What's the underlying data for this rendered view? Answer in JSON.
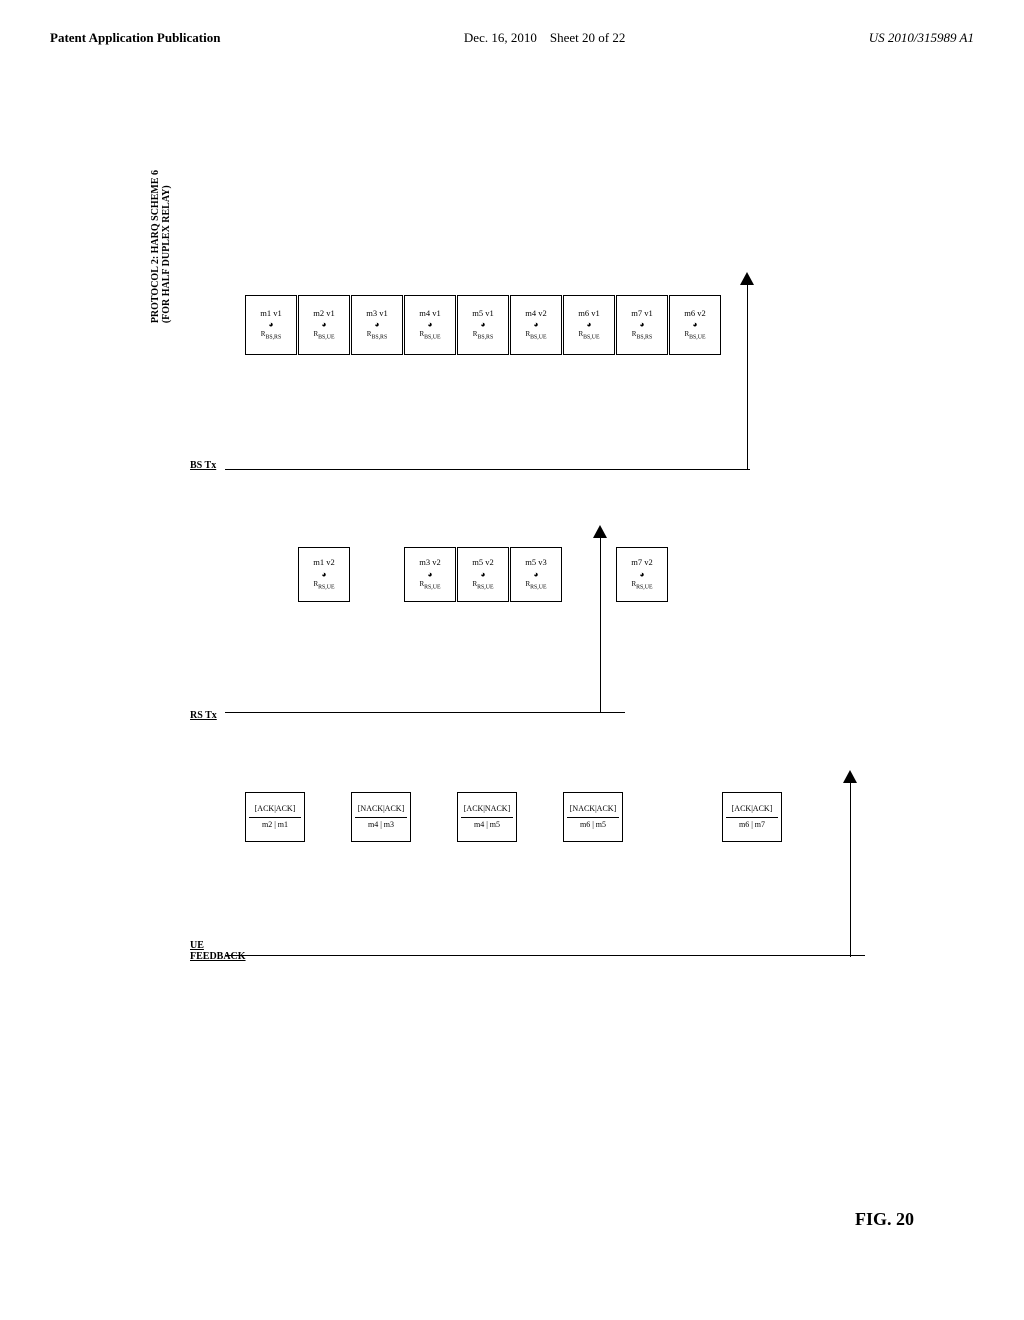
{
  "header": {
    "left": "Patent Application Publication",
    "center_date": "Dec. 16, 2010",
    "center_sheet": "Sheet 20 of 22",
    "right": "US 2010/315989 A1"
  },
  "title": {
    "line1": "PROTOCOL 2: HARQ SCHEME 6",
    "line2": "(FOR HALF DUPLEX RELAY)"
  },
  "rows": {
    "bs_tx": "BS Tx",
    "rs_tx": "RS Tx",
    "ue_feedback": "UE\nFEEDBACK"
  },
  "fig": "FIG. 20",
  "bs_messages": [
    {
      "id": "m1",
      "version": "v1",
      "label": "m1 v1",
      "sublabel": "R₂ₛ,RS"
    },
    {
      "id": "m2",
      "version": "v1",
      "label": "m2 v1",
      "sublabel": "R₂ₛ,UE"
    },
    {
      "id": "m3",
      "version": "v1",
      "label": "m3 v1",
      "sublabel": "R₂ₛ,RS"
    },
    {
      "id": "m4",
      "version": "v1",
      "label": "m4 v1",
      "sublabel": "R₂ₛ,UE"
    },
    {
      "id": "m5",
      "version": "v1",
      "label": "m5 v1",
      "sublabel": "R₂ₛ,RS"
    },
    {
      "id": "m4v2",
      "version": "v2",
      "label": "m4 v2",
      "sublabel": "R₂ₛ,UE"
    },
    {
      "id": "m6v1",
      "version": "v1",
      "label": "m6 v1",
      "sublabel": "R₂ₛ,UE"
    },
    {
      "id": "m7v1",
      "version": "v1",
      "label": "m7 v1",
      "sublabel": "R₂ₛ,RS"
    },
    {
      "id": "m6v2",
      "version": "v2",
      "label": "m6 v2",
      "sublabel": "R₂ₛ,UE"
    }
  ]
}
